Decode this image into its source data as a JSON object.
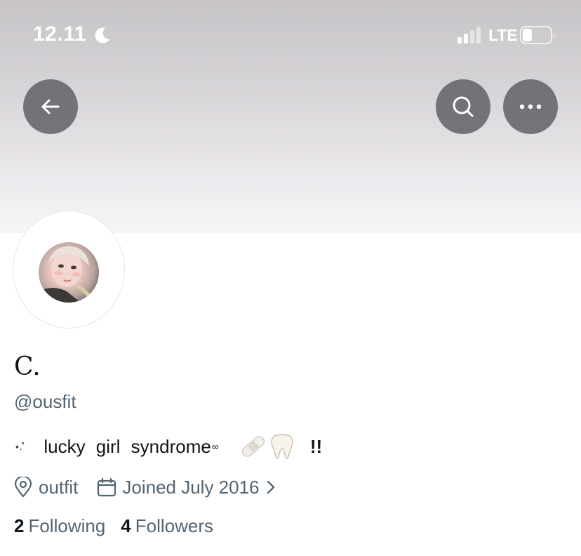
{
  "status_bar": {
    "time": "12.11",
    "network": "LTE"
  },
  "header": {
    "back_icon": "arrow-left-icon",
    "search_icon": "search-icon",
    "more_icon": "ellipsis-icon"
  },
  "profile": {
    "display_name": "C.",
    "handle": "@ousfit",
    "bio": {
      "decoration": "⋆.˚",
      "text": "lucky girl syndrome",
      "superscript": "∞",
      "emoji": [
        "🩹",
        "🦷"
      ],
      "suffix": "!!"
    },
    "location": "outfit",
    "joined": "Joined July 2016"
  },
  "stats": {
    "following_count": "2",
    "following_label": "Following",
    "followers_count": "4",
    "followers_label": "Followers"
  },
  "colors": {
    "primary_text": "#0f1419",
    "secondary_text": "#536471",
    "header_button_bg": "#5c5c60"
  }
}
